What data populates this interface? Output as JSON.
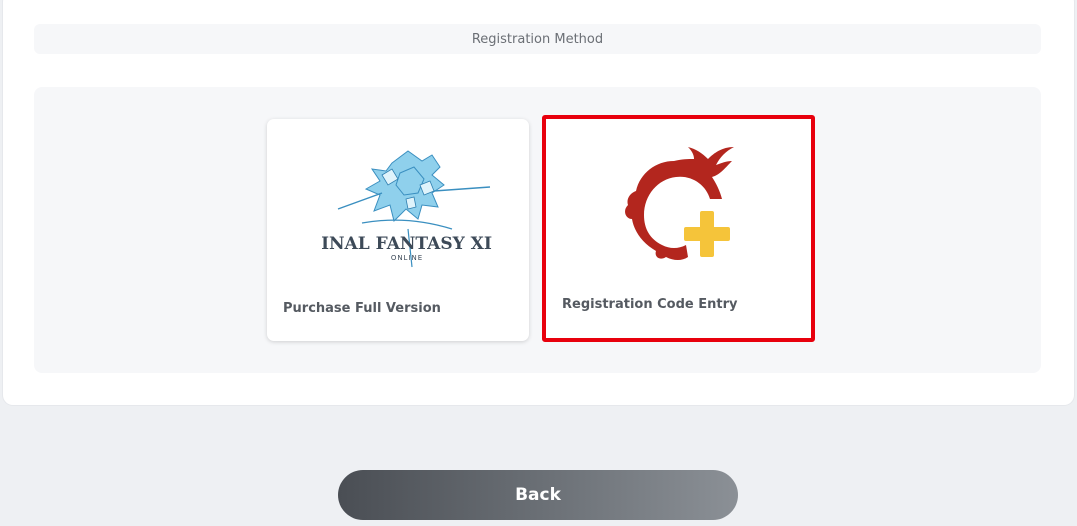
{
  "registration": {
    "section_title": "Registration Method",
    "options": [
      {
        "label": "Purchase Full Version",
        "icon": "ffxiv-logo-icon",
        "logo_text": "FINAL FANTASY XIV",
        "logo_subtext": "ONLINE"
      },
      {
        "label": "Registration Code Entry",
        "icon": "meteor-plus-icon",
        "selected": true
      }
    ]
  },
  "actions": {
    "back_label": "Back"
  },
  "colors": {
    "selected_border": "#e8000d",
    "meteor_red": "#b3261e",
    "plus_yellow": "#f5c43a"
  }
}
